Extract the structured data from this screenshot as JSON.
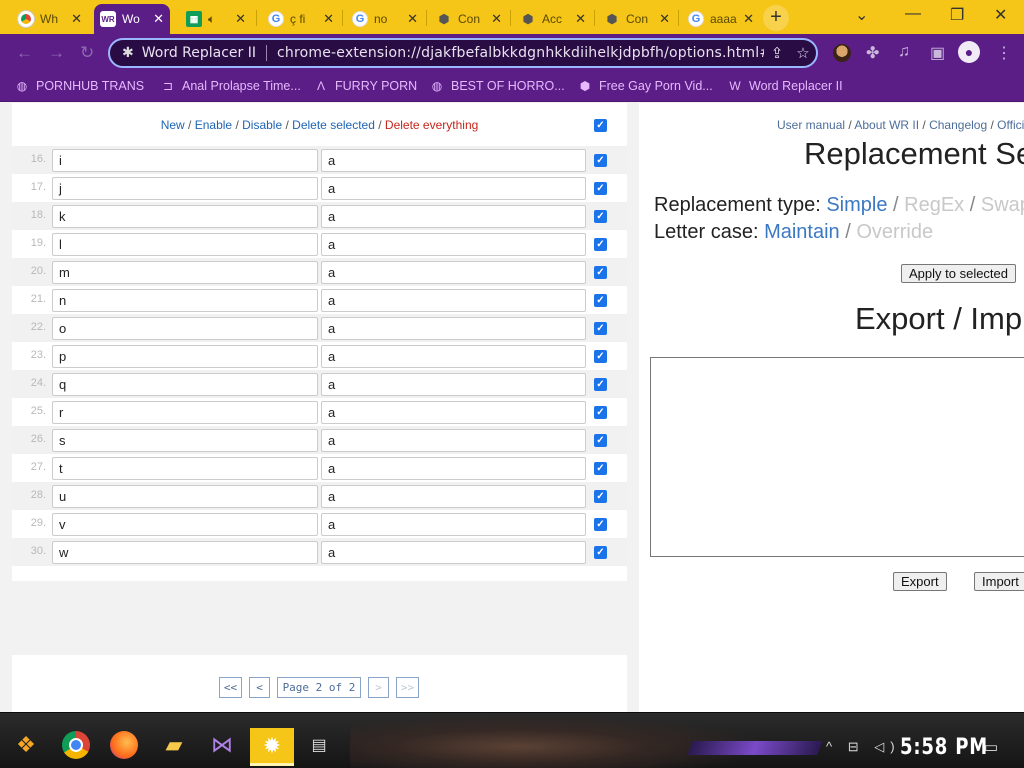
{
  "tabs": [
    {
      "title": "Wh",
      "favicon": "chrome-icon",
      "active": false
    },
    {
      "title": "Wo",
      "favicon": "word-replacer-icon",
      "active": true
    },
    {
      "title": "",
      "favicon": "spreadsheet-icon",
      "active": false,
      "audio": true
    },
    {
      "title": "ç fi",
      "favicon": "google-icon",
      "active": false
    },
    {
      "title": "no",
      "favicon": "google-icon",
      "active": false
    },
    {
      "title": "Con",
      "favicon": "extension-icon",
      "active": false
    },
    {
      "title": "Acc",
      "favicon": "extension-icon",
      "active": false
    },
    {
      "title": "Con",
      "favicon": "extension-icon",
      "active": false
    },
    {
      "title": "aaaa - ·",
      "favicon": "google-icon",
      "active": false
    }
  ],
  "omnibox": {
    "site_name": "Word Replacer II",
    "url": "chrome-extension://djakfbefalbkkdgnhkkdiihelkjdpbfh/options.html#"
  },
  "bookmarks": [
    {
      "label": "PORNHUB TRANS",
      "icon": "globe-icon"
    },
    {
      "label": "Anal Prolapse Time...",
      "icon": "bracket-icon"
    },
    {
      "label": "FURRY PORN",
      "icon": "lambda-icon"
    },
    {
      "label": "BEST OF HORRO...",
      "icon": "globe-icon"
    },
    {
      "label": "Free Gay Porn Vid...",
      "icon": "extension-icon"
    },
    {
      "label": "Word Replacer II",
      "icon": "word-replacer-icon"
    }
  ],
  "actions": {
    "new": "New",
    "enable": "Enable",
    "disable": "Disable",
    "delete_selected": "Delete selected",
    "delete_everything": "Delete everything",
    "sep": " / "
  },
  "rules": [
    {
      "num": "16.",
      "from": "i",
      "to": "a",
      "checked": true
    },
    {
      "num": "17.",
      "from": "j",
      "to": "a",
      "checked": true
    },
    {
      "num": "18.",
      "from": "k",
      "to": "a",
      "checked": true
    },
    {
      "num": "19.",
      "from": "l",
      "to": "a",
      "checked": true
    },
    {
      "num": "20.",
      "from": "m",
      "to": "a",
      "checked": true
    },
    {
      "num": "21.",
      "from": "n",
      "to": "a",
      "checked": true
    },
    {
      "num": "22.",
      "from": "o",
      "to": "a",
      "checked": true
    },
    {
      "num": "23.",
      "from": "p",
      "to": "a",
      "checked": true
    },
    {
      "num": "24.",
      "from": "q",
      "to": "a",
      "checked": true
    },
    {
      "num": "25.",
      "from": "r",
      "to": "a",
      "checked": true
    },
    {
      "num": "26.",
      "from": "s",
      "to": "a",
      "checked": true
    },
    {
      "num": "27.",
      "from": "t",
      "to": "a",
      "checked": true
    },
    {
      "num": "28.",
      "from": "u",
      "to": "a",
      "checked": true
    },
    {
      "num": "29.",
      "from": "v",
      "to": "a",
      "checked": true
    },
    {
      "num": "30.",
      "from": "w",
      "to": "a",
      "checked": true
    }
  ],
  "pager": {
    "first": "<<",
    "prev": "<",
    "label": "Page 2 of 2",
    "next": ">",
    "last": ">>"
  },
  "right": {
    "links": {
      "manual": "User manual",
      "about": "About WR II",
      "changelog": "Changelog",
      "official": "Offici",
      "sep": " / "
    },
    "replacement_heading": "Replacement Se",
    "replacement_type_label": "Replacement type:",
    "types": [
      "Simple",
      "RegEx",
      "Swap"
    ],
    "letter_case_label": "Letter case:",
    "cases": [
      "Maintain",
      "Override"
    ],
    "apply_button": "Apply to selected",
    "export_heading": "Export / Imp",
    "export_value": "",
    "export_button": "Export",
    "import_button": "Import"
  },
  "taskbar": {
    "clock": "5:58 PM",
    "active_app": "settings-icon"
  },
  "colors": {
    "tab_strip": "#f5c518",
    "toolbar": "#5b1d86",
    "link": "#1e64b4",
    "danger": "#c3261b",
    "checkbox": "#1a73e8"
  }
}
